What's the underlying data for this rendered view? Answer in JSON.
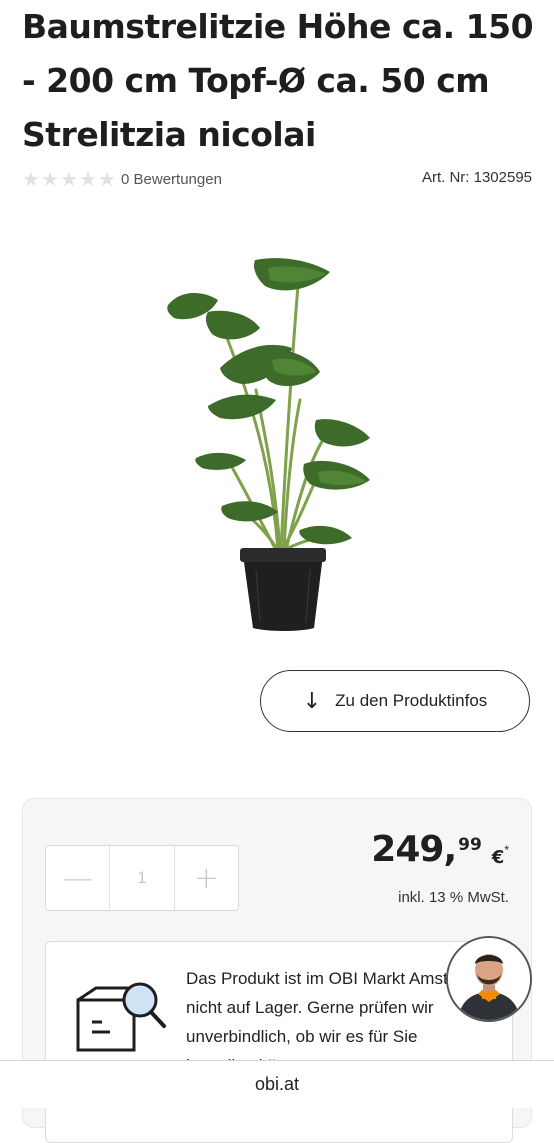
{
  "product": {
    "title": "Baumstrelitzie Höhe ca. 150 - 200 cm Topf-Ø ca. 50 cm Strelitzia nicolai",
    "rating": {
      "stars": 0,
      "max_stars": 5,
      "reviews_label": "0 Bewertungen"
    },
    "article_number": "Art. Nr: 1302595",
    "image_icon": "plant-in-pot-image"
  },
  "product_infos_button": {
    "label": "Zu den Produktinfos",
    "icon": "arrow-down-icon"
  },
  "buy_box": {
    "quantity": {
      "value": "1",
      "minus_icon": "minus-icon",
      "plus_icon": "plus-icon"
    },
    "price": {
      "main": "249,",
      "cents": "99",
      "currency": "€",
      "footnote": "*"
    },
    "vat": "inkl. 13 % MwSt.",
    "stock_message": "Das Produkt ist im OBI Markt Amstetten nicht auf Lager. Gerne prüfen wir unverbindlich, ob wir es für Sie bestellen können."
  },
  "chat_assistant": {
    "icon": "advisor-avatar"
  },
  "footer": {
    "domain": "obi.at"
  },
  "colors": {
    "accent": "#f28c00",
    "star_empty": "#e2e2e2",
    "text": "#1e1e1e"
  }
}
